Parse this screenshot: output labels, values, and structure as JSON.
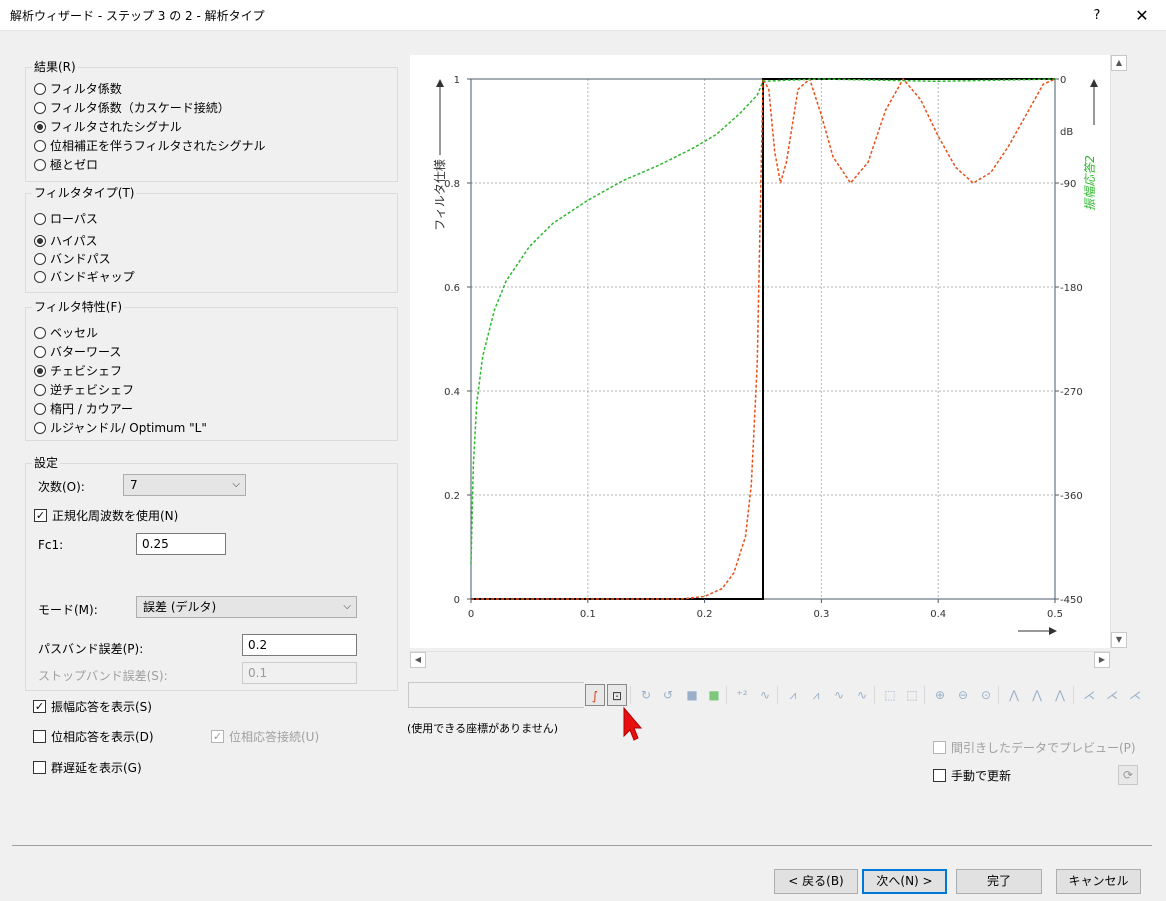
{
  "window": {
    "title": "解析ウィザード - ステップ 3 の 2 - 解析タイプ",
    "help": "?",
    "close": "✕"
  },
  "result_group": {
    "title": "結果(R)",
    "options": [
      "フィルタ係数",
      "フィルタ係数（カスケード接続）",
      "フィルタされたシグナル",
      "位相補正を伴うフィルタされたシグナル",
      "極とゼロ"
    ],
    "selected": 2
  },
  "filter_type_group": {
    "title": "フィルタタイプ(T)",
    "options": [
      "ローパス",
      "ハイパス",
      "バンドパス",
      "バンドギャップ"
    ],
    "selected": 1
  },
  "filter_char_group": {
    "title": "フィルタ特性(F)",
    "options": [
      "ベッセル",
      "バターワース",
      "チェビシェフ",
      "逆チェビシェフ",
      "楕円 / カウアー",
      "ルジャンドル/ Optimum \"L\""
    ],
    "selected": 2
  },
  "settings_group": {
    "title": "設定",
    "order_label": "次数(O):",
    "order_value": "7",
    "normalized_label": "正規化周波数を使用(N)",
    "normalized_checked": true,
    "fc1_label": "Fc1:",
    "fc1_value": "0.25",
    "mode_label": "モード(M):",
    "mode_value": "誤差 (デルタ)",
    "passband_label": "パスバンド誤差(P):",
    "passband_value": "0.2",
    "stopband_label": "ストップバンド誤差(S):",
    "stopband_value": "0.1"
  },
  "display_options": {
    "show_amplitude": "振幅応答を表示(S)",
    "show_amplitude_checked": true,
    "show_phase": "位相応答を表示(D)",
    "show_phase_checked": false,
    "phase_connect": "位相応答接続(U)",
    "phase_connect_checked": true,
    "show_group_delay": "群遅延を表示(G)",
    "show_group_delay_checked": false
  },
  "status": {
    "no_coords": "(使用できる座標がありません)"
  },
  "preview": {
    "decimated_preview": "間引きしたデータでプレビュー(P)",
    "manual_update": "手動で更新"
  },
  "buttons": {
    "back": "< 戻る(B)",
    "next": "次へ(N) >",
    "finish": "完了",
    "cancel": "キャンセル"
  },
  "toolbar_icons": [
    "curve-icon",
    "zoom-fit-icon",
    "rotate-cw-icon",
    "rotate-ccw-icon",
    "square-icon",
    "square-green-icon",
    "add-point-icon",
    "wave-icon",
    "wave-up-icon",
    "wave-up2-icon",
    "wave-down-icon",
    "wave-icon-2",
    "annotation-icon",
    "annotation2-icon",
    "zoom-in-icon",
    "zoom-out-icon",
    "zoom-reset-icon",
    "cursor-a-icon",
    "cursor-b-icon",
    "cursor-c-icon",
    "fit-a-icon",
    "fit-b-icon",
    "fit-c-icon"
  ],
  "chart_data": {
    "type": "line",
    "xlabel": "",
    "ylabel": "フィルタ仕様",
    "y2label": "振幅応答2",
    "y2unit": "dB",
    "xlim": [
      0,
      0.5
    ],
    "ylim": [
      0,
      1
    ],
    "y2lim": [
      -450,
      0
    ],
    "x_ticks": [
      "0",
      "0.1",
      "0.2",
      "0.3",
      "0.4",
      "0.5"
    ],
    "y_ticks": [
      "0",
      "0.2",
      "0.4",
      "0.6",
      "0.8",
      "1"
    ],
    "y2_ticks": [
      "-450",
      "-360",
      "-270",
      "-180",
      "-90",
      "0"
    ],
    "grid": true,
    "series": [
      {
        "name": "フィルタ仕様",
        "color": "#000000",
        "style": "solid",
        "x": [
          0,
          0.25,
          0.25,
          0.5
        ],
        "y": [
          0,
          0,
          1,
          1
        ]
      },
      {
        "name": "振幅応答",
        "color": "#e8501a",
        "style": "dotted",
        "x": [
          0,
          0.18,
          0.2,
          0.215,
          0.225,
          0.235,
          0.24,
          0.245,
          0.25,
          0.255,
          0.26,
          0.265,
          0.27,
          0.28,
          0.29,
          0.3,
          0.31,
          0.325,
          0.34,
          0.355,
          0.37,
          0.385,
          0.4,
          0.415,
          0.43,
          0.445,
          0.46,
          0.475,
          0.49,
          0.5
        ],
        "y": [
          0,
          0,
          0.005,
          0.02,
          0.05,
          0.12,
          0.22,
          0.45,
          1.0,
          0.98,
          0.86,
          0.8,
          0.84,
          0.98,
          1.0,
          0.93,
          0.85,
          0.8,
          0.84,
          0.94,
          1.0,
          0.96,
          0.89,
          0.83,
          0.8,
          0.82,
          0.87,
          0.93,
          0.99,
          1.0
        ]
      },
      {
        "name": "振幅応答2",
        "color": "#2eb82e",
        "style": "dotted",
        "axis": "y2",
        "x": [
          0,
          0.002,
          0.005,
          0.01,
          0.02,
          0.03,
          0.05,
          0.07,
          0.1,
          0.13,
          0.16,
          0.19,
          0.21,
          0.23,
          0.245,
          0.25,
          0.27,
          0.3,
          0.35,
          0.4,
          0.45,
          0.5
        ],
        "y": [
          -420,
          -335,
          -280,
          -240,
          -200,
          -175,
          -145,
          -125,
          -105,
          -88,
          -75,
          -60,
          -48,
          -30,
          -14,
          -2,
          -1,
          0,
          -1,
          -2,
          -1,
          0
        ]
      }
    ]
  }
}
